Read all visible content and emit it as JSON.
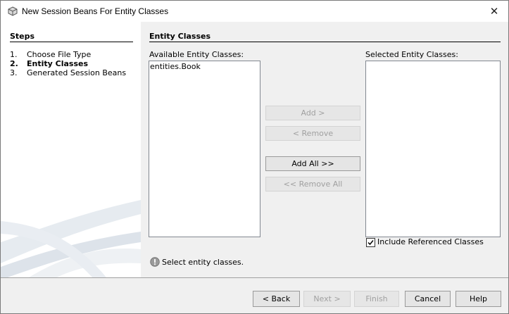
{
  "window": {
    "title": "New Session Beans For Entity Classes",
    "close_glyph": "✕",
    "icon": "netbeans-cube-icon"
  },
  "steps": {
    "title": "Steps",
    "items": [
      {
        "num": "1.",
        "label": "Choose File Type",
        "active": false
      },
      {
        "num": "2.",
        "label": "Entity Classes",
        "active": true
      },
      {
        "num": "3.",
        "label": "Generated Session Beans",
        "active": false
      }
    ]
  },
  "main": {
    "section_title": "Entity Classes",
    "available_label": "Available Entity Classes:",
    "available_items": [
      "entities.Book"
    ],
    "selected_label": "Selected Entity Classes:",
    "selected_items": [],
    "buttons": {
      "add": "Add >",
      "remove": "< Remove",
      "add_all": "Add All >>",
      "remove_all": "<< Remove All"
    },
    "include_referenced": {
      "label": "Include Referenced Classes",
      "checked": true
    },
    "status": {
      "icon": "info-icon",
      "text": "Select entity classes."
    }
  },
  "footer": {
    "back": "< Back",
    "next": "Next >",
    "finish": "Finish",
    "cancel": "Cancel",
    "help": "Help"
  }
}
